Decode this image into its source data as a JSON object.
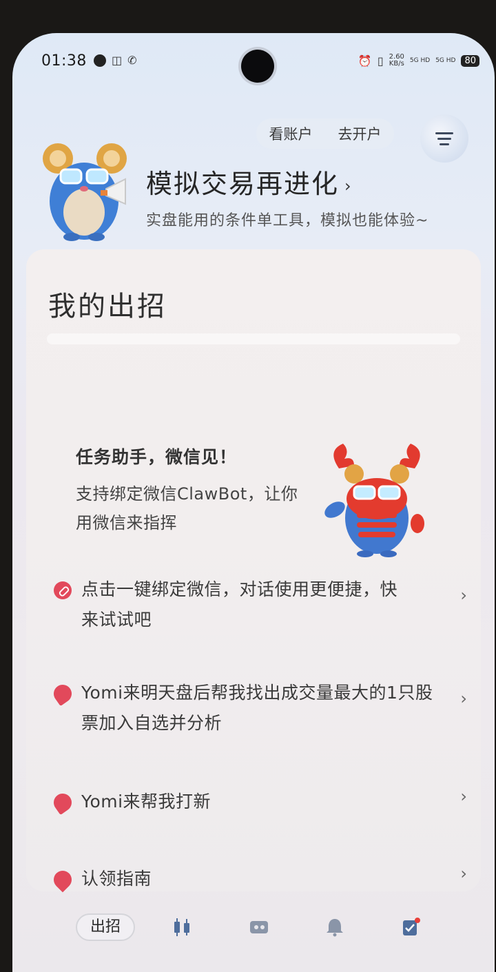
{
  "status_bar": {
    "time": "01:38",
    "net_speed_value": "2.60",
    "net_speed_unit": "KB/s",
    "signal_1": "5G HD",
    "signal_2": "5G HD",
    "battery": "80"
  },
  "header": {
    "view_account": "看账户",
    "open_account": "去开户"
  },
  "promo": {
    "title": "模拟交易再进化",
    "subtitle": "实盘能用的条件单工具，模拟也能体验~"
  },
  "card": {
    "title": "我的出招",
    "assistant": {
      "title": "任务助手，微信见！",
      "description": "支持绑定微信ClawBot，让你用微信来指挥"
    },
    "items": [
      {
        "icon": "link-icon",
        "text": "点击一键绑定微信，对话使用更便捷，快来试试吧"
      },
      {
        "icon": "flame-icon",
        "text": "Yomi来明天盘后帮我找出成交量最大的1只股票加入自选并分析"
      },
      {
        "icon": "flame-icon",
        "text": "Yomi来帮我打新"
      },
      {
        "icon": "pin-icon",
        "text": "认领指南"
      }
    ]
  },
  "tabbar": {
    "active_tab": "出招",
    "icons": [
      "candlestick-icon",
      "ticket-icon",
      "bell-icon",
      "checklist-icon"
    ]
  },
  "colors": {
    "accent_red": "#e2495b",
    "notification_dot": "#e8403a"
  }
}
